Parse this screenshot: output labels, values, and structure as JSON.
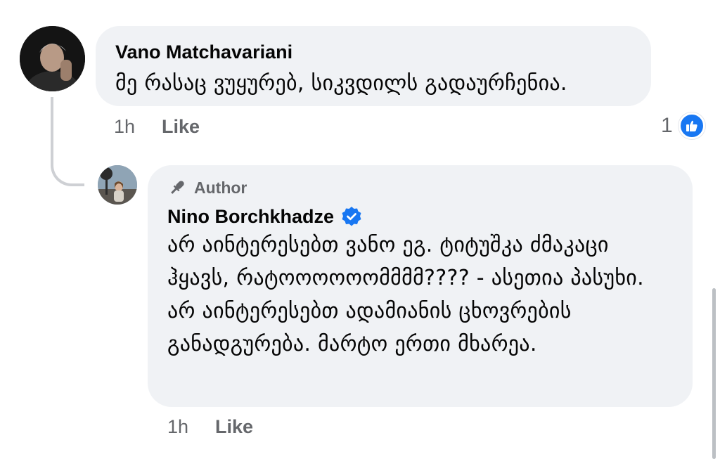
{
  "comments": [
    {
      "author": "Vano Matchavariani",
      "text": "მე რასაც ვუყურებ, სიკვდილს გადაურჩენია.",
      "time": "1h",
      "like_label": "Like",
      "reaction_count": "1"
    }
  ],
  "reply": {
    "badge_label": "Author",
    "author": "Nino Borchkhadze",
    "verified": true,
    "text": "არ აინტერესებთ ვანო ეგ. ტიტუშკა ძმაკაცი ჰყავს, რატოოოოოომმმმ???? - ასეთია პასუხი. არ აინტერესებთ ადამიანის ცხოვრების განადგურება. მარტო ერთი მხარეა.",
    "time": "1h",
    "like_label": "Like"
  },
  "colors": {
    "bubble": "#f0f2f5",
    "secondary_text": "#65676b",
    "accent": "#1877f2",
    "thread_line": "#ced0d4"
  }
}
